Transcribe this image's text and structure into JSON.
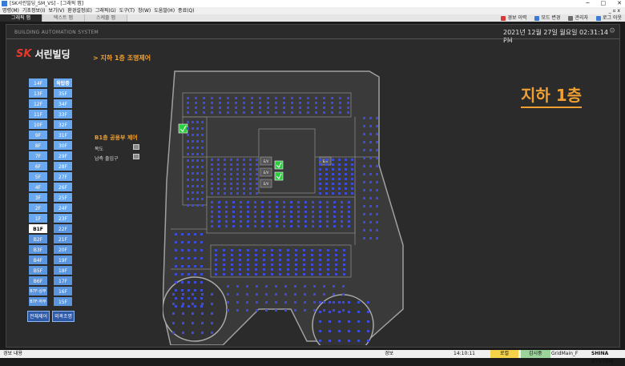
{
  "window": {
    "title": "[SK서린빌딩_SM_VS] - [그래픽 맵]",
    "controls": [
      "─",
      "□",
      "✕"
    ]
  },
  "menu": {
    "items": [
      "명령(M)",
      "기초정보(I)",
      "보기(V)",
      "환경설정(E)",
      "그래픽(G)",
      "도구(T)",
      "창(W)",
      "도움말(H)",
      "종료(Q)"
    ],
    "right": "_ ▫ x"
  },
  "tabs": [
    {
      "label": "그래픽 맵"
    },
    {
      "label": "텍스트 맵"
    },
    {
      "label": "스케줄 맵"
    }
  ],
  "toolbar": {
    "alarm": "경보 이력",
    "mode": "모드 변경",
    "admin": "관리자",
    "logout": "로그 아웃",
    "colors": {
      "alarm": "#d83a3a",
      "mode": "#3a7bd5",
      "admin": "#6a6a6a",
      "logout": "#3a7bd5"
    }
  },
  "header": {
    "system": "BUILDING AUTOMATION SYSTEM",
    "datetime": "2021년 12월 27일 월요일 02:31:14 PM"
  },
  "brand": {
    "sk": "SK",
    "name": "서린빌딩",
    "crumb": "> 지하 1층 조명제어"
  },
  "floors": {
    "left": [
      "14F",
      "13F",
      "12F",
      "11F",
      "10F",
      "9F",
      "8F",
      "7F",
      "6F",
      "5F",
      "4F",
      "3F",
      "2F",
      "1F",
      "B1F",
      "B2F",
      "B3F",
      "B4F",
      "B5F",
      "B6F",
      "B7F-상부",
      "B7F-하부"
    ],
    "right_header": "옥탑층",
    "right": [
      "35F",
      "34F",
      "33F",
      "32F",
      "31F",
      "30F",
      "29F",
      "28F",
      "27F",
      "26F",
      "25F",
      "24F",
      "23F",
      "22F",
      "21F",
      "20F",
      "19F",
      "18F",
      "17F",
      "16F",
      "15F"
    ],
    "selected": "B1F",
    "all_control": "전체제어",
    "exterior": "외곽조명"
  },
  "b1": {
    "title": "B1층 공용부 제어",
    "rows": [
      {
        "label": "복도"
      },
      {
        "label": "남측 출입구"
      }
    ]
  },
  "big_title": "지하 1층",
  "plan_labels": {
    "ev": "E/V"
  },
  "statusbar": {
    "left": "경보 내용",
    "alarm": "경보",
    "time": "14:10:11",
    "ok": "로컬",
    "state": "감시중",
    "user": "GridMain_F",
    "company": "SHINA SYSTEM"
  },
  "colors": {
    "accent": "#f0a030",
    "floor_btn": "#6aa9f0",
    "plan_bg": "#3a3a3a",
    "wall": "#a0a0a0",
    "light": "#3d4bd8",
    "light_on": "#2ecc40"
  }
}
